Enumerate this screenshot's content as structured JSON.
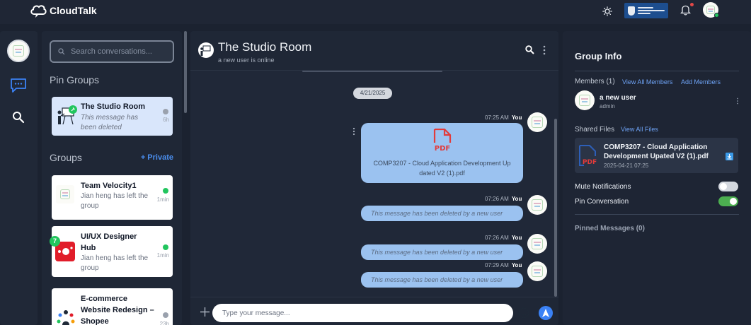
{
  "app": {
    "name": "CloudTalk"
  },
  "colors": {
    "accent": "#3b82f6",
    "online": "#22c55e",
    "bubble": "#9bc2f0",
    "pdf": "#e23b3b"
  },
  "topbar": {
    "icons": [
      "theme-sun-icon",
      "university-logo",
      "bell-icon",
      "user-avatar"
    ],
    "university_logo_lettering": "University of Southampton MALAYSIA"
  },
  "rail": {
    "icons": [
      "avatar",
      "chat-bubble-icon",
      "search-icon"
    ]
  },
  "sidebar": {
    "search": {
      "placeholder": "Search conversations..."
    },
    "pin_groups_title": "Pin Groups",
    "groups_title": "Groups",
    "private_link": "+ Private",
    "pinned": [
      {
        "name": "The Studio Room",
        "preview": "This message has been deleted",
        "time": "6h",
        "status": "gray",
        "icon": "presenter-icon"
      }
    ],
    "groups": [
      {
        "name": "Team Velocity1",
        "preview": "Jian heng has left the group",
        "time": "1min",
        "status": "green",
        "icon": "avatar"
      },
      {
        "name": "UI/UX Designer Hub",
        "preview": "Jian heng has left the group",
        "time": "1min",
        "status": "green",
        "unread": "7",
        "icon": "design-hub-icon"
      },
      {
        "name": "E-commerce Website Redesign – Shopee",
        "preview": "",
        "time": "23h",
        "status": "gray",
        "icon": "team-icon"
      }
    ]
  },
  "chat": {
    "title": "The Studio Room",
    "subtitle": "a new user is online",
    "date": "4/21/2025",
    "messages": [
      {
        "time": "07:25 AM",
        "sender": "You",
        "type": "file",
        "file_badge": "PDF",
        "file_name": "COMP3207 - Cloud Application Development Up dated V2 (1).pdf"
      },
      {
        "time": "07:26 AM",
        "sender": "You",
        "type": "deleted",
        "text": "This message has been deleted by a new user"
      },
      {
        "time": "07:26 AM",
        "sender": "You",
        "type": "deleted",
        "text": "This message has been deleted by a new user"
      },
      {
        "time": "07:29 AM",
        "sender": "You",
        "type": "deleted",
        "text": "This message has been deleted by a new user"
      }
    ],
    "composer": {
      "placeholder": "Type your message..."
    }
  },
  "info": {
    "title": "Group Info",
    "members_label": "Members (1)",
    "view_all_members": "View All Members",
    "add_members": "Add Members",
    "member": {
      "name": "a new user",
      "role": "admin"
    },
    "shared_files_label": "Shared Files",
    "view_all_files": "View All Files",
    "shared_file": {
      "name": "COMP3207 - Cloud Application Development Upated V2 (1).pdf",
      "date": "2025-04-21 07:25",
      "badge": "PDF"
    },
    "mute_label": "Mute Notifications",
    "mute_on": false,
    "pin_label": "Pin Conversation",
    "pin_on": true,
    "pinned_messages": "Pinned Messages (0)"
  }
}
